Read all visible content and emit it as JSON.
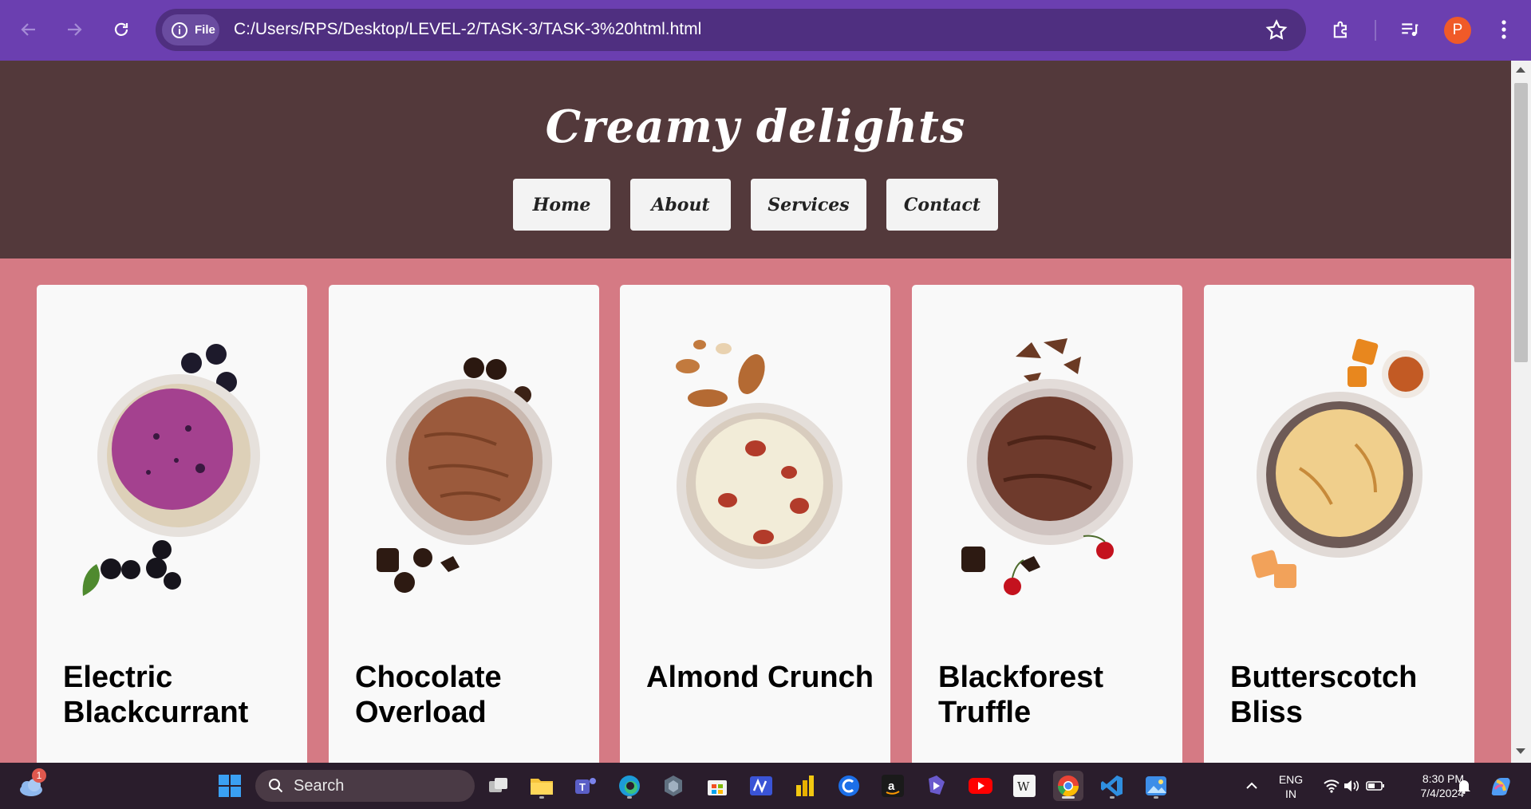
{
  "browser": {
    "site_chip": "File",
    "url": "C:/Users/RPS/Desktop/LEVEL-2/TASK-3/TASK-3%20html.html",
    "profile_initial": "P"
  },
  "page": {
    "title": "Creamy delights",
    "nav": [
      "Home",
      "About",
      "Services",
      "Contact"
    ],
    "cards": [
      {
        "title": "Electric Blackcurrant",
        "scoop": "#a4418f"
      },
      {
        "title": "Chocolate Overload",
        "scoop": "#9b5a3c"
      },
      {
        "title": "Almond Crunch",
        "scoop": "#f2ecd8"
      },
      {
        "title": "Blackforest Truffle",
        "scoop": "#6e3a2c"
      },
      {
        "title": "Butterscotch Bliss",
        "scoop": "#f0cf8c"
      }
    ]
  },
  "taskbar": {
    "search_label": "Search",
    "weather_badge": "1",
    "language": [
      "ENG",
      "IN"
    ],
    "time": "8:30 PM",
    "date": "7/4/2024"
  },
  "colors": {
    "chrome": "#6b3fb0",
    "header": "#53393b",
    "page_bg": "#d57a84",
    "card_bg": "#f9f9f9"
  }
}
